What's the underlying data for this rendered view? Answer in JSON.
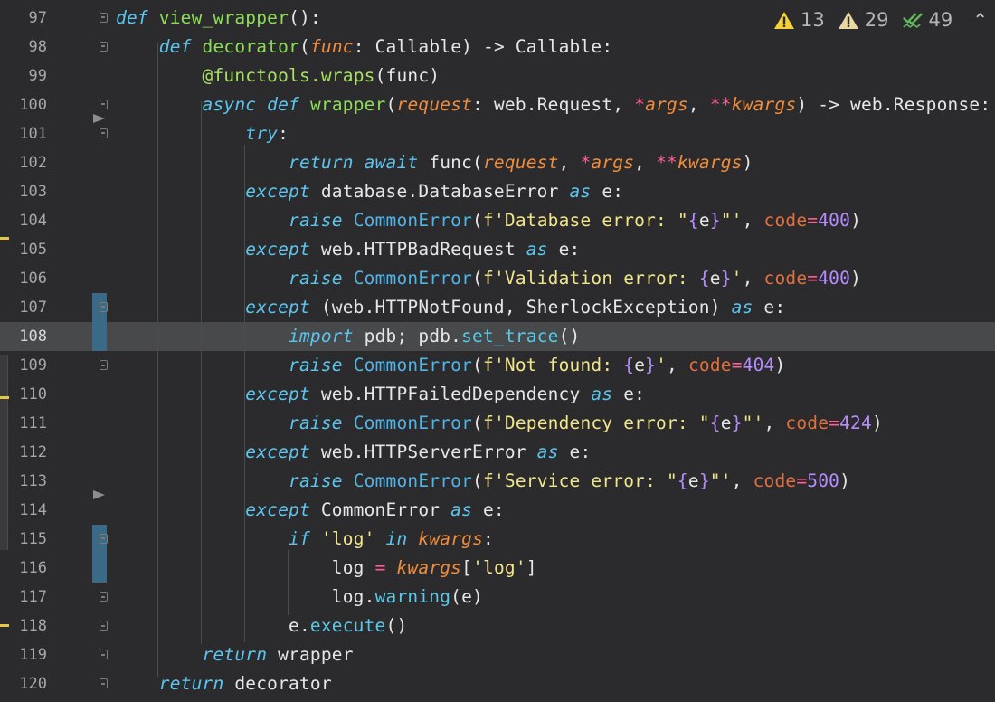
{
  "inspections": {
    "warnings_yellow": "13",
    "warnings_weak": "29",
    "typos": "49",
    "collapse_icon": "chevron-up-icon"
  },
  "colors": {
    "background": "#2b2b2d",
    "current_line": "#48494b",
    "keyword": "#5cc5ef",
    "function": "#8dde57",
    "parameter": "#f08d3c",
    "string": "#f2e58a",
    "number": "#b78cff",
    "operator": "#ff5e91"
  },
  "editor": {
    "current_line": "108",
    "lines": [
      {
        "num": "97",
        "tokens": [
          [
            "k",
            "def"
          ],
          [
            "pl",
            " "
          ],
          [
            "fn",
            "view_wrapper"
          ],
          [
            "pl",
            "():"
          ]
        ]
      },
      {
        "num": "98",
        "tokens": [
          [
            "pl",
            "    "
          ],
          [
            "k",
            "def"
          ],
          [
            "pl",
            " "
          ],
          [
            "fn",
            "decorator"
          ],
          [
            "pl",
            "("
          ],
          [
            "p",
            "func"
          ],
          [
            "pl",
            ": Callable) -> Callable:"
          ]
        ]
      },
      {
        "num": "99",
        "tokens": [
          [
            "pl",
            "        "
          ],
          [
            "dec",
            "@functools.wraps"
          ],
          [
            "pl",
            "(func)"
          ]
        ]
      },
      {
        "num": "100",
        "tokens": [
          [
            "pl",
            "        "
          ],
          [
            "k",
            "async def"
          ],
          [
            "pl",
            " "
          ],
          [
            "fn",
            "wrapper"
          ],
          [
            "pl",
            "("
          ],
          [
            "p",
            "request"
          ],
          [
            "pl",
            ": web.Request, "
          ],
          [
            "op",
            "*"
          ],
          [
            "p",
            "args"
          ],
          [
            "pl",
            ", "
          ],
          [
            "op",
            "**"
          ],
          [
            "p",
            "kwargs"
          ],
          [
            "pl",
            ") -> web.Response:"
          ]
        ]
      },
      {
        "num": "101",
        "tokens": [
          [
            "pl",
            "            "
          ],
          [
            "k",
            "try"
          ],
          [
            "pl",
            ":"
          ]
        ]
      },
      {
        "num": "102",
        "tokens": [
          [
            "pl",
            "                "
          ],
          [
            "k",
            "return await"
          ],
          [
            "pl",
            " func("
          ],
          [
            "p",
            "request"
          ],
          [
            "pl",
            ", "
          ],
          [
            "op",
            "*"
          ],
          [
            "p",
            "args"
          ],
          [
            "pl",
            ", "
          ],
          [
            "op",
            "**"
          ],
          [
            "p",
            "kwargs"
          ],
          [
            "pl",
            ")"
          ]
        ]
      },
      {
        "num": "103",
        "tokens": [
          [
            "pl",
            "            "
          ],
          [
            "k",
            "except"
          ],
          [
            "pl",
            " database.DatabaseError "
          ],
          [
            "k",
            "as"
          ],
          [
            "pl",
            " e:"
          ]
        ]
      },
      {
        "num": "104",
        "tokens": [
          [
            "pl",
            "                "
          ],
          [
            "k",
            "raise"
          ],
          [
            "pl",
            " "
          ],
          [
            "cls",
            "CommonError"
          ],
          [
            "pl",
            "("
          ],
          [
            "str",
            "f'Database error: \""
          ],
          [
            "br",
            "{"
          ],
          [
            "pl",
            "e"
          ],
          [
            "br",
            "}"
          ],
          [
            "str",
            "\"'"
          ],
          [
            "pl",
            ", "
          ],
          [
            "kw",
            "code"
          ],
          [
            "op",
            "="
          ],
          [
            "num",
            "400"
          ],
          [
            "pl",
            ")"
          ]
        ]
      },
      {
        "num": "105",
        "tokens": [
          [
            "pl",
            "            "
          ],
          [
            "k",
            "except"
          ],
          [
            "pl",
            " web.HTTPBadRequest "
          ],
          [
            "k",
            "as"
          ],
          [
            "pl",
            " e:"
          ]
        ]
      },
      {
        "num": "106",
        "tokens": [
          [
            "pl",
            "                "
          ],
          [
            "k",
            "raise"
          ],
          [
            "pl",
            " "
          ],
          [
            "cls",
            "CommonError"
          ],
          [
            "pl",
            "("
          ],
          [
            "str",
            "f'Validation error: "
          ],
          [
            "br",
            "{"
          ],
          [
            "pl",
            "e"
          ],
          [
            "br",
            "}"
          ],
          [
            "str",
            "'"
          ],
          [
            "pl",
            ", "
          ],
          [
            "kw",
            "code"
          ],
          [
            "op",
            "="
          ],
          [
            "num",
            "400"
          ],
          [
            "pl",
            ")"
          ]
        ]
      },
      {
        "num": "107",
        "tokens": [
          [
            "pl",
            "            "
          ],
          [
            "k",
            "except"
          ],
          [
            "pl",
            " (web.HTTPNotFound, SherlockException) "
          ],
          [
            "k",
            "as"
          ],
          [
            "pl",
            " e:"
          ]
        ]
      },
      {
        "num": "108",
        "tokens": [
          [
            "pl",
            "                "
          ],
          [
            "k",
            "import"
          ],
          [
            "pl",
            " pdb; pdb."
          ],
          [
            "at",
            "set_trace"
          ],
          [
            "pl",
            "()"
          ]
        ]
      },
      {
        "num": "109",
        "tokens": [
          [
            "pl",
            "                "
          ],
          [
            "k",
            "raise"
          ],
          [
            "pl",
            " "
          ],
          [
            "cls",
            "CommonError"
          ],
          [
            "pl",
            "("
          ],
          [
            "str",
            "f'Not found: "
          ],
          [
            "br",
            "{"
          ],
          [
            "pl",
            "e"
          ],
          [
            "br",
            "}"
          ],
          [
            "str",
            "'"
          ],
          [
            "pl",
            ", "
          ],
          [
            "kw",
            "code"
          ],
          [
            "op",
            "="
          ],
          [
            "num",
            "404"
          ],
          [
            "pl",
            ")"
          ]
        ]
      },
      {
        "num": "110",
        "tokens": [
          [
            "pl",
            "            "
          ],
          [
            "k",
            "except"
          ],
          [
            "pl",
            " web.HTTPFailedDependency "
          ],
          [
            "k",
            "as"
          ],
          [
            "pl",
            " e:"
          ]
        ]
      },
      {
        "num": "111",
        "tokens": [
          [
            "pl",
            "                "
          ],
          [
            "k",
            "raise"
          ],
          [
            "pl",
            " "
          ],
          [
            "cls",
            "CommonError"
          ],
          [
            "pl",
            "("
          ],
          [
            "str",
            "f'Dependency error: \""
          ],
          [
            "br",
            "{"
          ],
          [
            "pl",
            "e"
          ],
          [
            "br",
            "}"
          ],
          [
            "str",
            "\"'"
          ],
          [
            "pl",
            ", "
          ],
          [
            "kw",
            "code"
          ],
          [
            "op",
            "="
          ],
          [
            "num",
            "424"
          ],
          [
            "pl",
            ")"
          ]
        ]
      },
      {
        "num": "112",
        "tokens": [
          [
            "pl",
            "            "
          ],
          [
            "k",
            "except"
          ],
          [
            "pl",
            " web.HTTPServerError "
          ],
          [
            "k",
            "as"
          ],
          [
            "pl",
            " e:"
          ]
        ]
      },
      {
        "num": "113",
        "tokens": [
          [
            "pl",
            "                "
          ],
          [
            "k",
            "raise"
          ],
          [
            "pl",
            " "
          ],
          [
            "cls",
            "CommonError"
          ],
          [
            "pl",
            "("
          ],
          [
            "str",
            "f'Service error: \""
          ],
          [
            "br",
            "{"
          ],
          [
            "pl",
            "e"
          ],
          [
            "br",
            "}"
          ],
          [
            "str",
            "\"'"
          ],
          [
            "pl",
            ", "
          ],
          [
            "kw",
            "code"
          ],
          [
            "op",
            "="
          ],
          [
            "num",
            "500"
          ],
          [
            "pl",
            ")"
          ]
        ]
      },
      {
        "num": "114",
        "tokens": [
          [
            "pl",
            "            "
          ],
          [
            "k",
            "except"
          ],
          [
            "pl",
            " CommonError "
          ],
          [
            "k",
            "as"
          ],
          [
            "pl",
            " e:"
          ]
        ]
      },
      {
        "num": "115",
        "tokens": [
          [
            "pl",
            "                "
          ],
          [
            "k",
            "if"
          ],
          [
            "pl",
            " "
          ],
          [
            "str",
            "'log'"
          ],
          [
            "pl",
            " "
          ],
          [
            "k",
            "in"
          ],
          [
            "pl",
            " "
          ],
          [
            "p",
            "kwargs"
          ],
          [
            "pl",
            ":"
          ]
        ]
      },
      {
        "num": "116",
        "tokens": [
          [
            "pl",
            "                    log "
          ],
          [
            "op",
            "="
          ],
          [
            "pl",
            " "
          ],
          [
            "p",
            "kwargs"
          ],
          [
            "pl",
            "["
          ],
          [
            "str",
            "'log'"
          ],
          [
            "pl",
            "]"
          ]
        ]
      },
      {
        "num": "117",
        "tokens": [
          [
            "pl",
            "                    log."
          ],
          [
            "at",
            "warning"
          ],
          [
            "pl",
            "(e)"
          ]
        ]
      },
      {
        "num": "118",
        "tokens": [
          [
            "pl",
            "                e."
          ],
          [
            "at",
            "execute"
          ],
          [
            "pl",
            "()"
          ]
        ]
      },
      {
        "num": "119",
        "tokens": [
          [
            "pl",
            "        "
          ],
          [
            "k",
            "return"
          ],
          [
            "pl",
            " wrapper"
          ]
        ]
      },
      {
        "num": "120",
        "tokens": [
          [
            "pl",
            "    "
          ],
          [
            "k",
            "return"
          ],
          [
            "pl",
            " decorator"
          ]
        ]
      }
    ]
  }
}
